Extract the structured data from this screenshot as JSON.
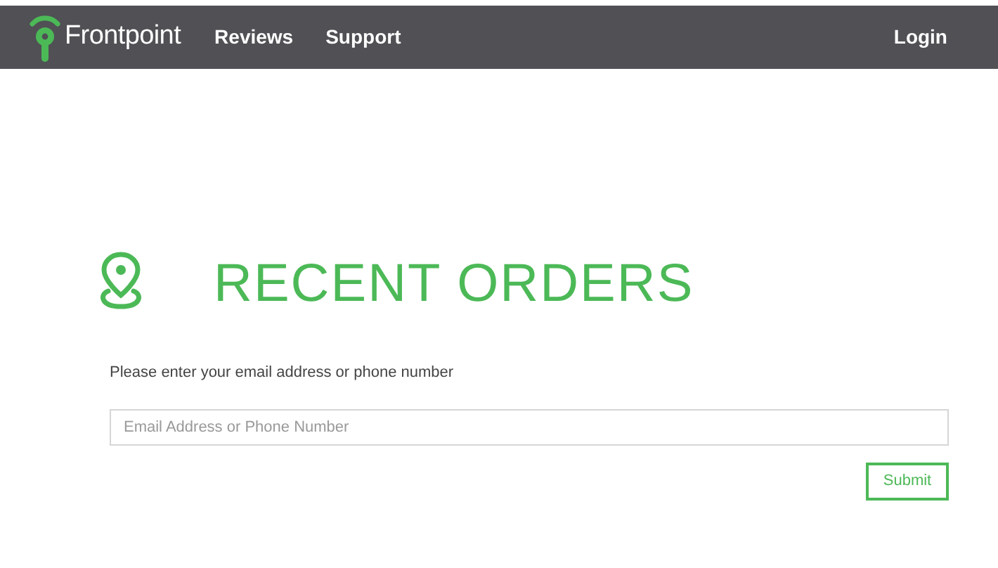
{
  "header": {
    "brand": "Frontpoint",
    "nav": [
      "Reviews",
      "Support"
    ],
    "login": "Login"
  },
  "title": "RECENT ORDERS",
  "instruction": "Please enter your email address or phone number",
  "input": {
    "placeholder": "Email Address or Phone Number"
  },
  "submit": "Submit"
}
